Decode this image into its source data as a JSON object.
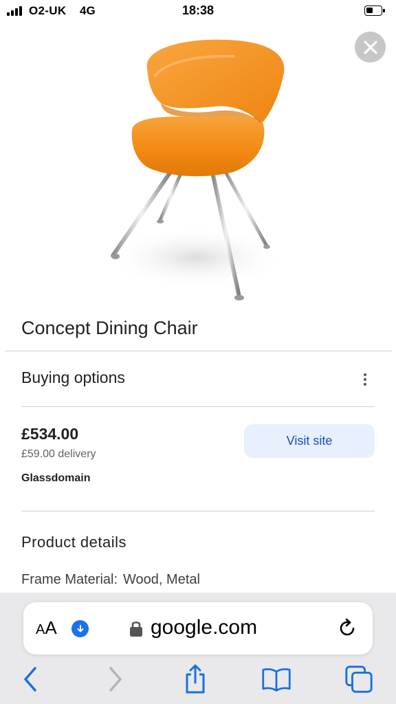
{
  "status_bar": {
    "carrier": "O2-UK",
    "network": "4G",
    "time": "18:38",
    "battery_level": 0.45
  },
  "product": {
    "title": "Concept Dining Chair",
    "image_icon": "orange-chair-image"
  },
  "buying_options": {
    "title": "Buying options",
    "price": "£534.00",
    "delivery": "£59.00 delivery",
    "merchant": "Glassdomain",
    "visit_label": "Visit site"
  },
  "product_details": {
    "title": "Product details",
    "frame_material_label": "Frame Material:",
    "frame_material_value": "Wood, Metal"
  },
  "browser": {
    "aa_small": "A",
    "aa_large": "A",
    "domain": "google.com",
    "accent": "#1a73e8",
    "toolbar_accent": "#1a6fe0"
  },
  "colors": {
    "chair_orange": "#f28a14",
    "visit_button_bg": "#e8f0fe",
    "visit_button_text": "#1a4dbc"
  }
}
